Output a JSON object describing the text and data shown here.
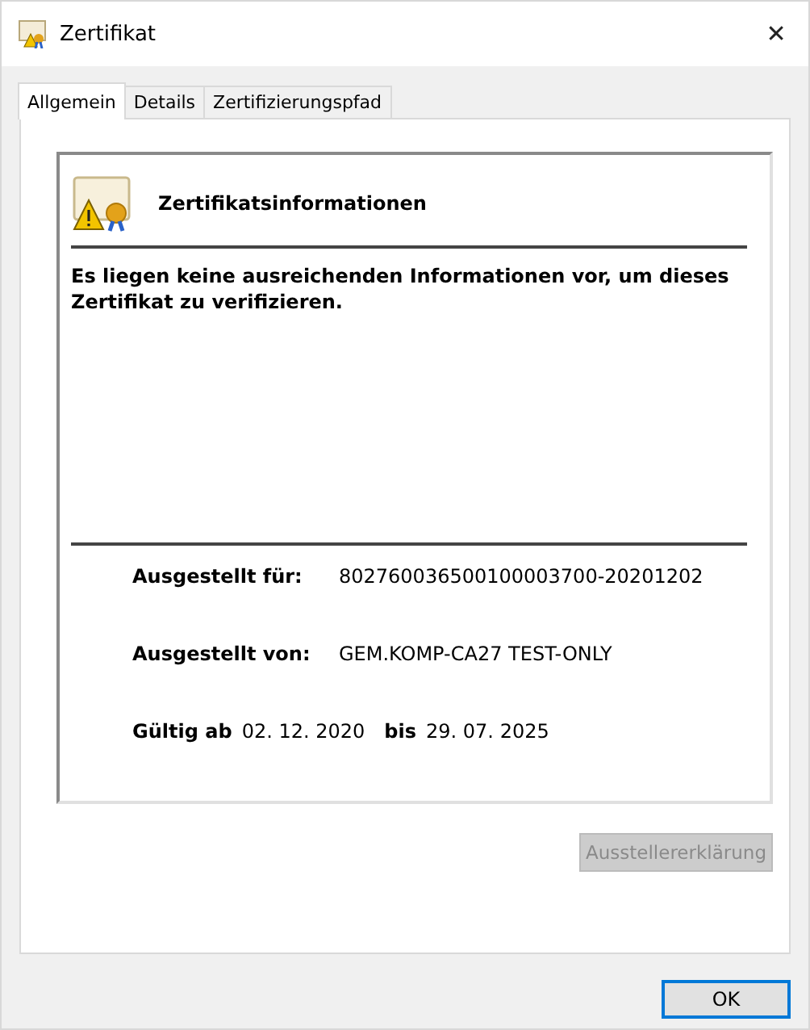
{
  "window": {
    "title": "Zertifikat",
    "close": "✕"
  },
  "tabs": [
    {
      "label": "Allgemein",
      "selected": true
    },
    {
      "label": "Details",
      "selected": false
    },
    {
      "label": "Zertifizierungspfad",
      "selected": false
    }
  ],
  "info": {
    "heading": "Zertifikatsinformationen",
    "message": "Es liegen keine ausreichenden Informationen vor, um dieses Zertifikat zu verifizieren."
  },
  "fields": [
    {
      "label": "Ausgestellt für:",
      "value": "802760036500100003700-20201202"
    },
    {
      "label": "Ausgestellt von:",
      "value": "GEM.KOMP-CA27 TEST-ONLY"
    }
  ],
  "validity": {
    "from_label": "Gültig ab",
    "from": "02. 12. 2020",
    "to_label": "bis",
    "to": "29. 07. 2025"
  },
  "issuer_statement": {
    "label": "Ausstellererklärung",
    "disabled": true
  },
  "buttons": [
    "OK"
  ]
}
